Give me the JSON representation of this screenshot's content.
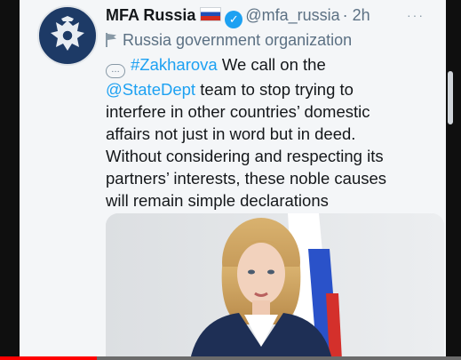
{
  "tweet": {
    "display_name": "MFA Russia",
    "handle": "@mfa_russia",
    "time": "· 2h",
    "more_glyph": "···",
    "label": "Russia government organization",
    "lines": [
      {
        "hashtag": "#Zakharova",
        "text": " We call on the"
      },
      {
        "mention": "@StateDept",
        "text": " team to stop trying to"
      },
      {
        "text": "interfere in other countries’ domestic"
      },
      {
        "text": "affairs not just in word but in deed."
      },
      {
        "text": "Without considering and respecting its"
      },
      {
        "text": "partners’ interests, these noble causes"
      },
      {
        "text": "will remain simple declarations"
      }
    ]
  },
  "icons": {
    "avatar": "russian-coat-of-arms",
    "flag": "russia-flag",
    "verified": "verified-badge",
    "label": "government-flag",
    "thread": "speech-bubble"
  },
  "colors": {
    "link": "#1da1f2",
    "secondary_text": "#5b7083",
    "video_progress": "#ff0000"
  },
  "video": {
    "progress": 0.21
  }
}
